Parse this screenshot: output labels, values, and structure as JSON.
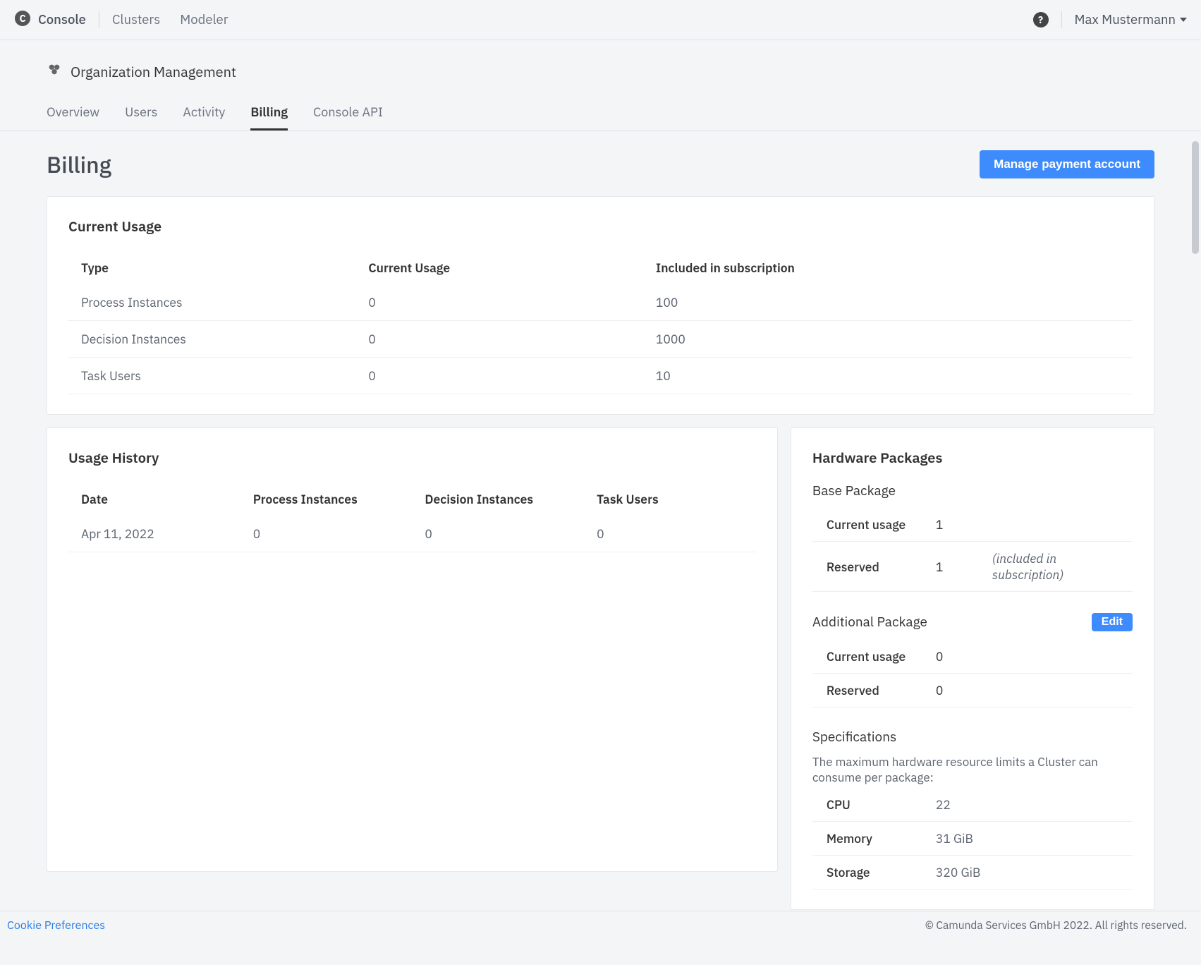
{
  "topbar": {
    "app": "Console",
    "links": [
      "Clusters",
      "Modeler"
    ],
    "user": "Max Mustermann"
  },
  "breadcrumb": "Organization Management",
  "tabs": [
    "Overview",
    "Users",
    "Activity",
    "Billing",
    "Console API"
  ],
  "active_tab": "Billing",
  "page_title": "Billing",
  "manage_btn": "Manage payment account",
  "current_usage": {
    "title": "Current Usage",
    "headers": [
      "Type",
      "Current Usage",
      "Included in subscription"
    ],
    "rows": [
      {
        "type": "Process Instances",
        "usage": "0",
        "included": "100"
      },
      {
        "type": "Decision Instances",
        "usage": "0",
        "included": "1000"
      },
      {
        "type": "Task Users",
        "usage": "0",
        "included": "10"
      }
    ]
  },
  "usage_history": {
    "title": "Usage History",
    "headers": [
      "Date",
      "Process Instances",
      "Decision Instances",
      "Task Users"
    ],
    "rows": [
      {
        "date": "Apr 11, 2022",
        "pi": "0",
        "di": "0",
        "tu": "0"
      }
    ]
  },
  "hardware": {
    "title": "Hardware Packages",
    "base": {
      "title": "Base Package",
      "rows": [
        {
          "k": "Current usage",
          "v": "1",
          "note": ""
        },
        {
          "k": "Reserved",
          "v": "1",
          "note": "(included in subscription)"
        }
      ]
    },
    "additional": {
      "title": "Additional Package",
      "edit": "Edit",
      "rows": [
        {
          "k": "Current usage",
          "v": "0",
          "note": ""
        },
        {
          "k": "Reserved",
          "v": "0",
          "note": ""
        }
      ]
    },
    "specs": {
      "title": "Specifications",
      "desc": "The maximum hardware resource limits a Cluster can consume per package:",
      "rows": [
        {
          "k": "CPU",
          "v": "22"
        },
        {
          "k": "Memory",
          "v": "31 GiB"
        },
        {
          "k": "Storage",
          "v": "320 GiB"
        }
      ]
    }
  },
  "footer": {
    "cookie": "Cookie Preferences",
    "copy": "© Camunda Services GmbH 2022. All rights reserved."
  }
}
